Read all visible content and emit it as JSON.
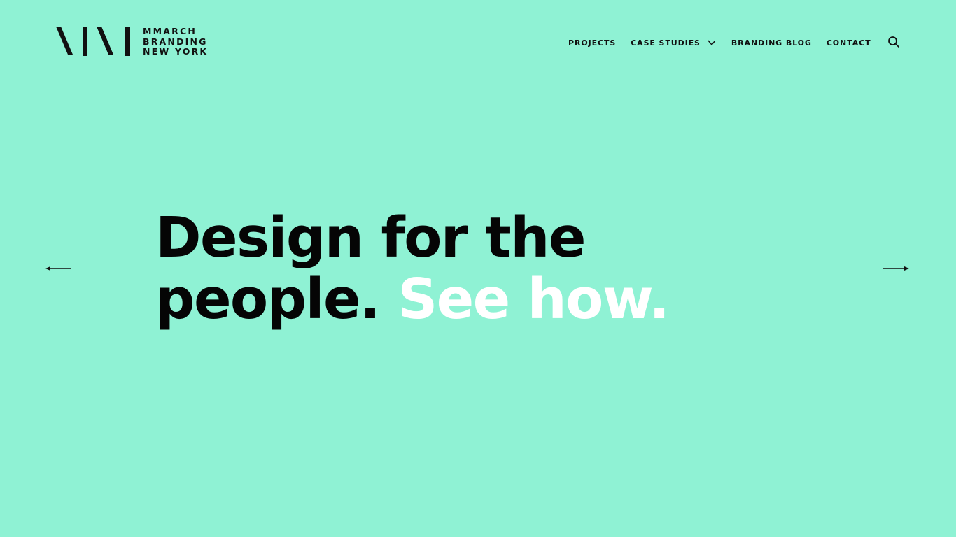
{
  "brand": {
    "logo_lines": [
      "MMARCH",
      "BRANDING",
      "NEW YORK"
    ],
    "background_color": "#8ff2d4",
    "text_color": "#111111",
    "accent_color": "#ffffff"
  },
  "nav": {
    "items": [
      {
        "label": "PROJECTS"
      },
      {
        "label": "CASE STUDIES",
        "icon": "chevron-down-icon"
      },
      {
        "label": "BRANDING BLOG"
      },
      {
        "label": "CONTACT"
      }
    ],
    "search_icon": "search-icon"
  },
  "hero": {
    "line1": "Design for the",
    "line2_dark": "people.",
    "line2_accent": "See how."
  },
  "slider": {
    "prev_icon": "arrow-left-icon",
    "next_icon": "arrow-right-icon"
  }
}
